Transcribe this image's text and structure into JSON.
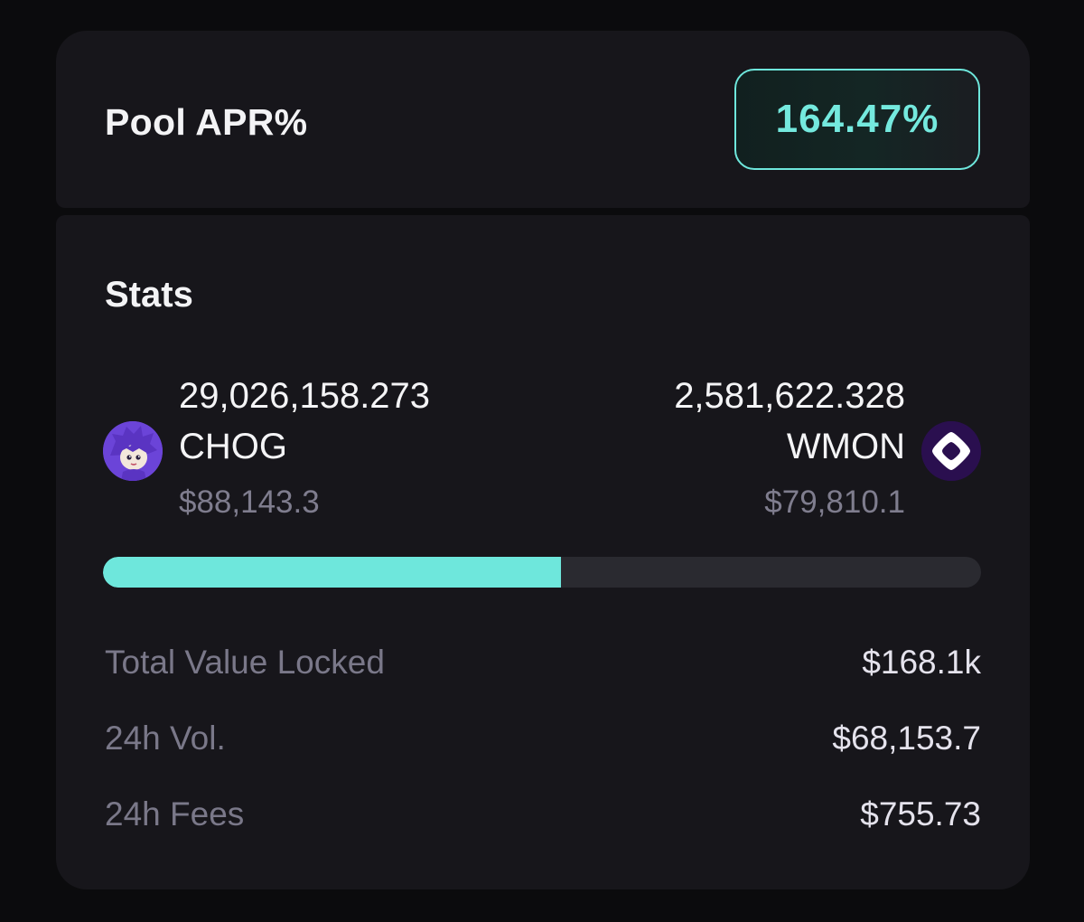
{
  "apr": {
    "label": "Pool APR%",
    "value": "164.47%"
  },
  "stats": {
    "title": "Stats",
    "token_a": {
      "amount": "29,026,158.273",
      "symbol": "CHOG",
      "usd": "$88,143.3",
      "icon": "chog-avatar-icon"
    },
    "token_b": {
      "amount": "2,581,622.328",
      "symbol": "WMON",
      "usd": "$79,810.1",
      "icon": "monad-diamond-icon"
    },
    "ratio_bar": {
      "token_a_fraction": 0.522,
      "fill_color": "#6ee7dc",
      "track_color": "#2a2a30"
    },
    "rows": [
      {
        "label": "Total Value Locked",
        "value": "$168.1k"
      },
      {
        "label": "24h Vol.",
        "value": "$68,153.7"
      },
      {
        "label": "24h Fees",
        "value": "$755.73"
      }
    ]
  },
  "colors": {
    "accent": "#6ee7dc",
    "card": "#17161b",
    "background": "#0b0b0d"
  }
}
